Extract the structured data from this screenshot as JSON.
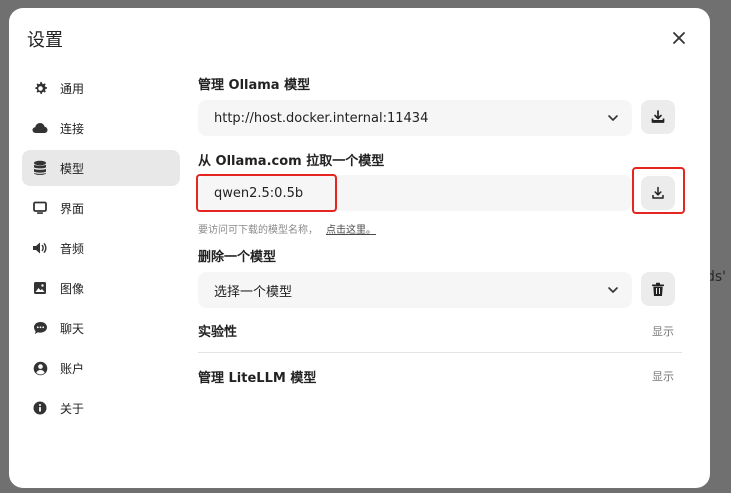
{
  "dialog": {
    "title": "设置"
  },
  "sidebar": {
    "items": [
      {
        "label": "通用",
        "icon": "gear-icon"
      },
      {
        "label": "连接",
        "icon": "cloud-icon"
      },
      {
        "label": "模型",
        "icon": "database-icon",
        "active": true
      },
      {
        "label": "界面",
        "icon": "monitor-icon"
      },
      {
        "label": "音频",
        "icon": "speaker-icon"
      },
      {
        "label": "图像",
        "icon": "image-icon"
      },
      {
        "label": "聊天",
        "icon": "chat-bubble-icon"
      },
      {
        "label": "账户",
        "icon": "user-circle-icon"
      },
      {
        "label": "关于",
        "icon": "info-icon"
      }
    ]
  },
  "main": {
    "manage_ollama_label": "管理 Ollama 模型",
    "ollama_url": "http://host.docker.internal:11434",
    "pull_label": "从 Ollama.com 拉取一个模型",
    "pull_input_value": "qwen2.5:0.5b",
    "pull_hint": "要访问可下载的模型名称，",
    "pull_hint_link": "点击这里。",
    "delete_label": "删除一个模型",
    "delete_select_value": "选择一个模型",
    "experimental_label": "实验性",
    "experimental_action": "显示",
    "litellm_label": "管理 LiteLLM 模型",
    "litellm_action": "显示"
  },
  "background": {
    "partial_text": "ds'"
  },
  "colors": {
    "highlight_border": "#e5251f",
    "active_sidebar_bg": "#e8e8e8",
    "field_bg": "#f6f6f6"
  }
}
